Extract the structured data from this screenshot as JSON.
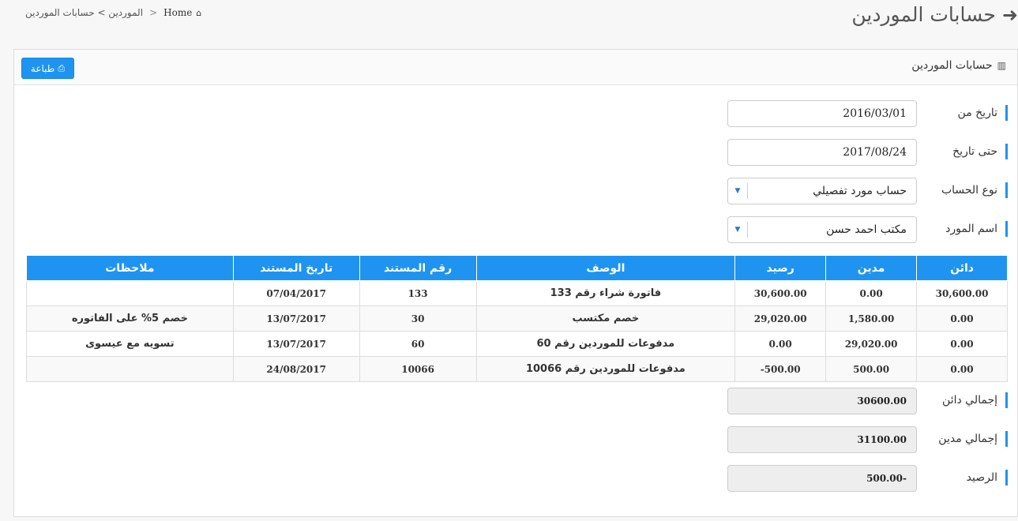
{
  "page": {
    "title": "حسابات الموردين",
    "back_icon": "arrow-left-icon"
  },
  "breadcrumb": {
    "home_label": "Home",
    "current_label": "الموردين > حسابات الموردين",
    "separator": ">"
  },
  "panel": {
    "title": "حسابات الموردين",
    "print_label": "طباعة"
  },
  "form": {
    "date_from_label": "تاريخ من",
    "date_from_value": "2016/03/01",
    "date_to_label": "حتى تاريخ",
    "date_to_value": "2017/08/24",
    "account_type_label": "نوع الحساب",
    "account_type_value": "حساب مورد تفصيلي",
    "supplier_label": "اسم المورد",
    "supplier_value": "مكتب احمد حسن"
  },
  "table": {
    "headers": [
      "دائن",
      "مدين",
      "رصيد",
      "الوصف",
      "رقم المستند",
      "تاريخ المستند",
      "ملاحظات"
    ],
    "rows": [
      [
        "30,600.00",
        "0.00",
        "30,600.00",
        "فاتورة شراء رقم 133",
        "133",
        "07/04/2017",
        ""
      ],
      [
        "0.00",
        "1,580.00",
        "29,020.00",
        "خصم مكتسب",
        "30",
        "13/07/2017",
        "خصم 5% على الفاتوره"
      ],
      [
        "0.00",
        "29,020.00",
        "0.00",
        "مدفوعات للموردين رقم 60",
        "60",
        "13/07/2017",
        "تسويه مع عيسوى"
      ],
      [
        "0.00",
        "500.00",
        "-500.00",
        "مدفوعات للموردين رقم 10066",
        "10066",
        "24/08/2017",
        ""
      ]
    ]
  },
  "totals": {
    "credit_label": "إجمالي دائن",
    "credit_value": "30600.00",
    "debit_label": "إجمالي مدين",
    "debit_value": "31100.00",
    "balance_label": "الرصيد",
    "balance_value": "-500.00"
  },
  "colors": {
    "accent": "#1e94f0"
  }
}
